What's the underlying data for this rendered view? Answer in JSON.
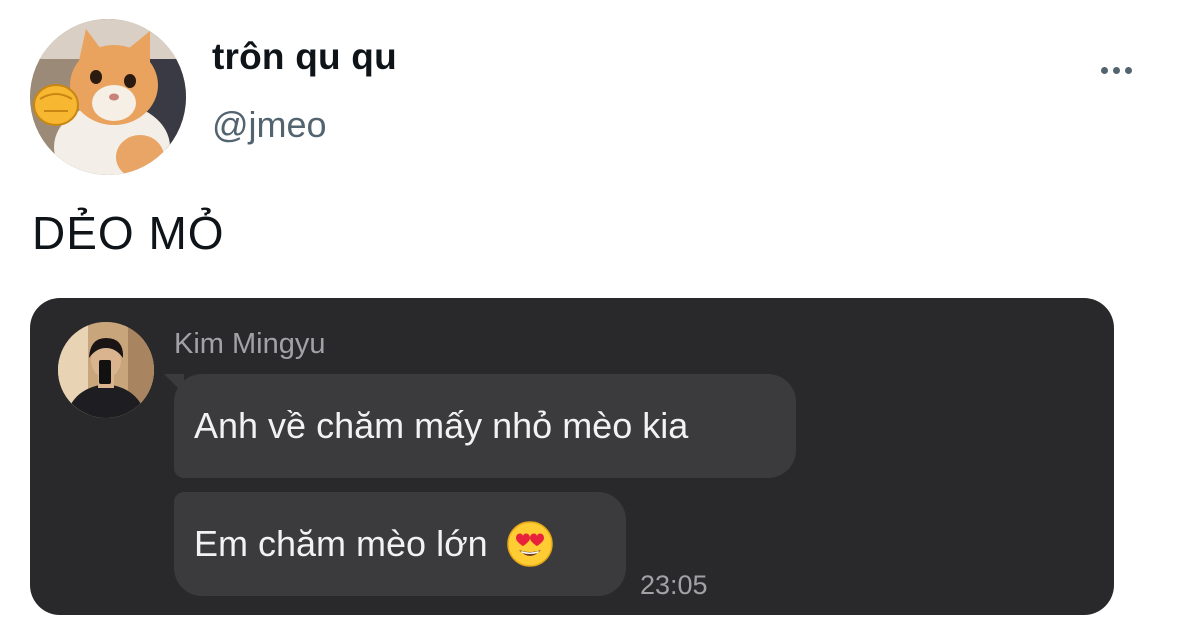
{
  "tweet": {
    "author": {
      "display_name": "trôn qu qu",
      "handle": "@jmeo",
      "avatar_icon": "cat-avatar-icon"
    },
    "menu_icon": "more-options-icon",
    "text": "DẺO MỎ"
  },
  "chat": {
    "sender": {
      "name": "Kim Mingyu",
      "avatar_icon": "person-avatar-icon"
    },
    "messages": [
      {
        "text": "Anh về chăm mấy nhỏ mèo kia"
      },
      {
        "text": "Em chăm mèo lớn",
        "emoji_icon": "heart-eyes-emoji-icon"
      }
    ],
    "timestamp": "23:05"
  },
  "colors": {
    "background": "#ffffff",
    "primary_text": "#0f1419",
    "secondary_text": "#536471",
    "chat_background": "#29292b",
    "bubble_background": "#3b3b3d",
    "chat_meta_text": "#a2a2a6"
  }
}
